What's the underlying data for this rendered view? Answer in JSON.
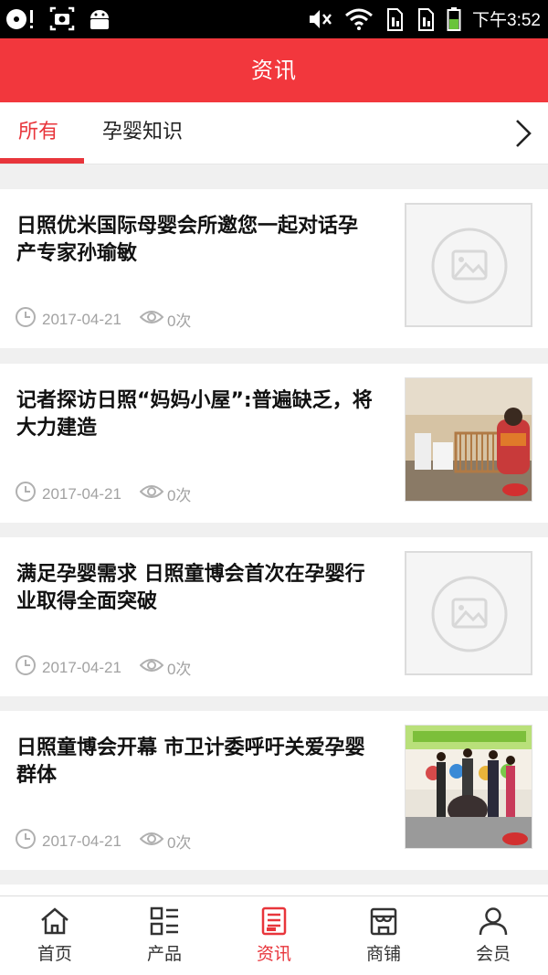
{
  "status_bar": {
    "time": "下午3:52"
  },
  "header": {
    "title": "资讯"
  },
  "tabs": [
    {
      "label": "所有",
      "active": true
    },
    {
      "label": "孕婴知识",
      "active": false
    }
  ],
  "articles": [
    {
      "title": "日照优米国际母婴会所邀您一起对话孕产专家孙瑜敏",
      "date": "2017-04-21",
      "views": "0次",
      "thumbnail": "placeholder-image-icon"
    },
    {
      "title": "记者探访日照“妈妈小屋”:普遍缺乏，将大力建造",
      "date": "2017-04-21",
      "views": "0次",
      "thumbnail": "photo-nursing-room"
    },
    {
      "title": "满足孕婴需求 日照童博会首次在孕婴行业取得全面突破",
      "date": "2017-04-21",
      "views": "0次",
      "thumbnail": "placeholder-image-icon"
    },
    {
      "title": "日照童博会开幕 市卫计委呼吁关爱孕婴群体",
      "date": "2017-04-21",
      "views": "0次",
      "thumbnail": "photo-expo-opening"
    }
  ],
  "bottom_nav": [
    {
      "label": "首页",
      "icon": "home-icon",
      "active": false
    },
    {
      "label": "产品",
      "icon": "grid-list-icon",
      "active": false
    },
    {
      "label": "资讯",
      "icon": "news-icon",
      "active": true
    },
    {
      "label": "商铺",
      "icon": "store-icon",
      "active": false
    },
    {
      "label": "会员",
      "icon": "user-icon",
      "active": false
    }
  ],
  "colors": {
    "brand": "#f2373d",
    "active": "#e8353b",
    "muted": "#a2a2a2"
  }
}
